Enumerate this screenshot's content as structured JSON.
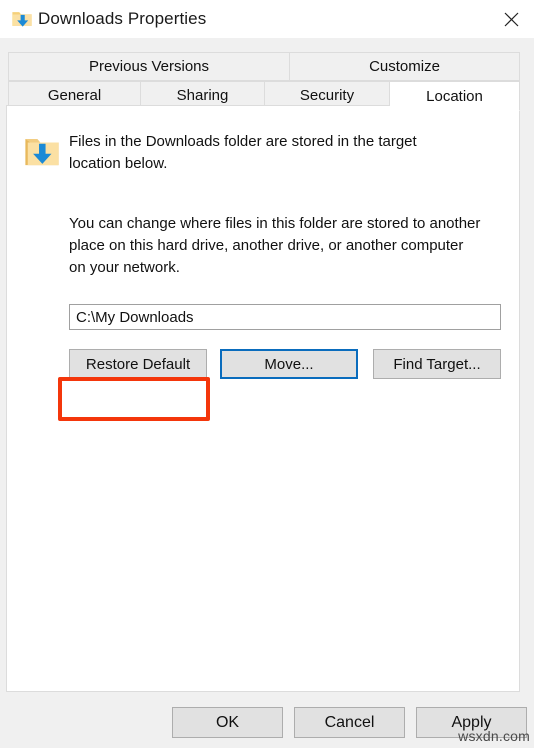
{
  "window": {
    "title": "Downloads Properties",
    "icon": "downloads-folder-icon",
    "close_label": "✕"
  },
  "tabs": {
    "row1": [
      {
        "label": "Previous Versions",
        "selected": false
      },
      {
        "label": "Customize",
        "selected": false
      }
    ],
    "row2": [
      {
        "label": "General",
        "selected": false
      },
      {
        "label": "Sharing",
        "selected": false
      },
      {
        "label": "Security",
        "selected": false
      },
      {
        "label": "Location",
        "selected": true
      }
    ]
  },
  "panel": {
    "info_text": "Files in the Downloads folder are stored in the target location below.",
    "description": "You can change where files in this folder are stored to another place on this hard drive, another drive, or another computer on your network.",
    "path_field": {
      "value": "C:\\My Downloads",
      "placeholder": "Folder location"
    },
    "buttons": {
      "restore_default": "Restore Default",
      "move": "Move...",
      "find_target": "Find Target..."
    }
  },
  "footer": {
    "ok": "OK",
    "cancel": "Cancel",
    "apply": "Apply"
  },
  "annotation": {
    "highlight_target": "restore-default-button",
    "highlight_color": "#f4360b",
    "focus_color": "#0a6cbd"
  },
  "watermark": "wsxdn.com"
}
